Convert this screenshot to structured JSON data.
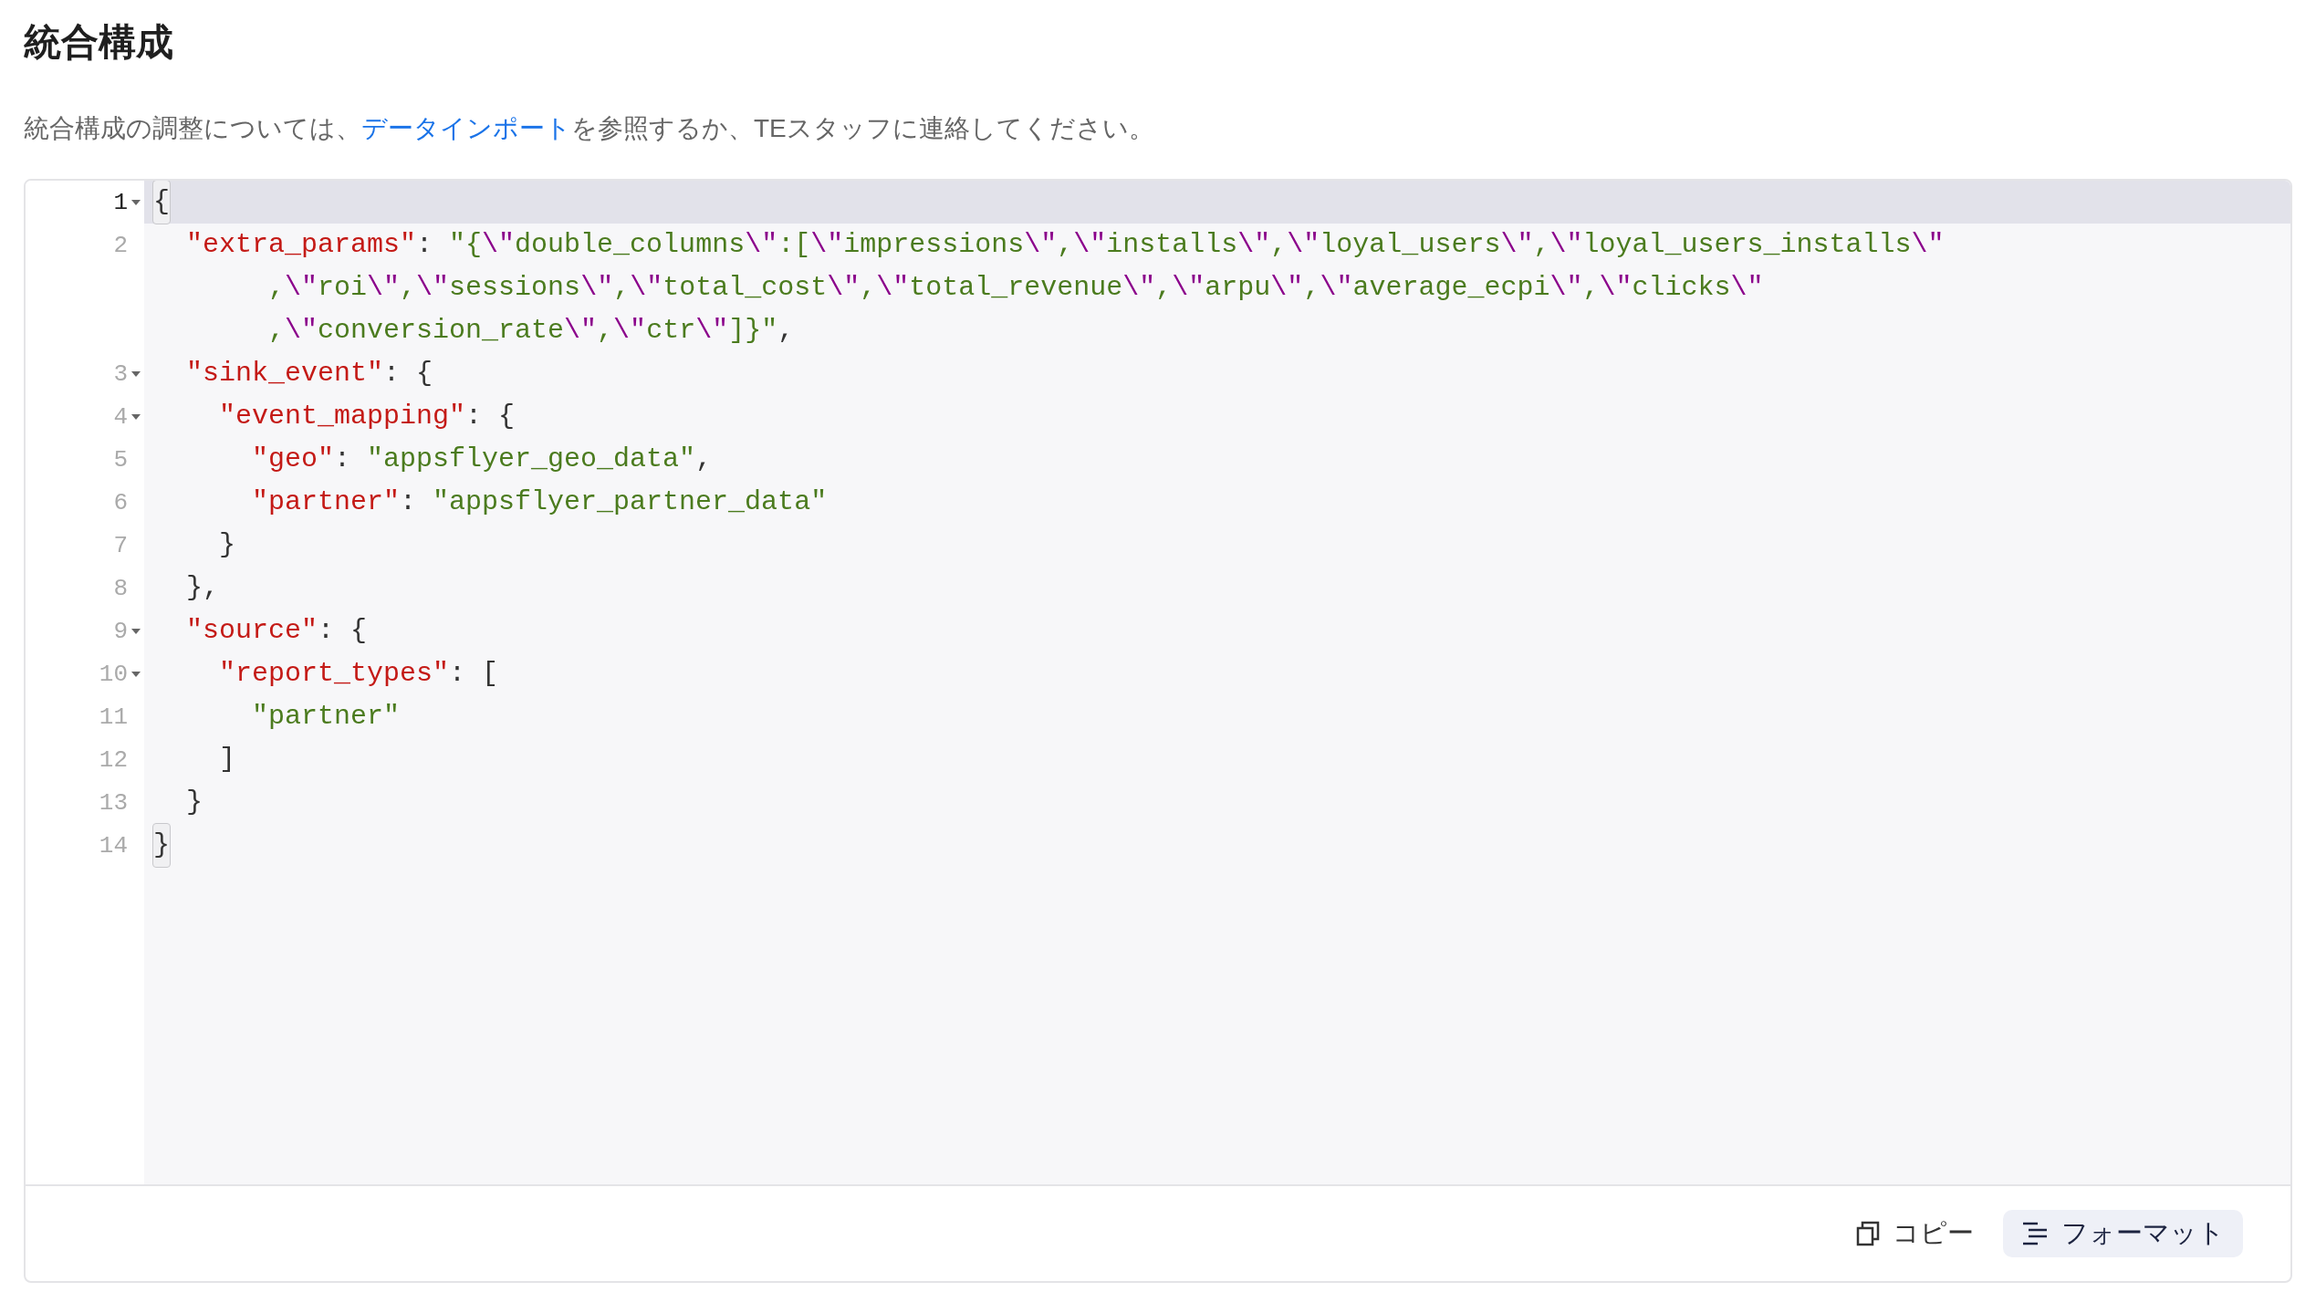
{
  "title": "統合構成",
  "description": {
    "before": "統合構成の調整については、",
    "link": "データインポート",
    "after": "を参照するか、TEスタッフに連絡してください。"
  },
  "editor": {
    "lines": [
      {
        "number": "1",
        "foldable": true,
        "active": true,
        "parts": [
          {
            "tokens": [
              {
                "kind": "punc",
                "text": "{",
                "matched": true
              }
            ]
          }
        ]
      },
      {
        "number": "2",
        "foldable": false,
        "active": false,
        "parts": [
          {
            "tokens": [
              {
                "kind": "key",
                "text": "  \"extra_params\""
              },
              {
                "kind": "punc",
                "text": ": "
              },
              {
                "kind": "str",
                "text": "\"{"
              },
              {
                "kind": "esc",
                "text": "\\\""
              },
              {
                "kind": "str",
                "text": "double_columns"
              },
              {
                "kind": "esc",
                "text": "\\\""
              },
              {
                "kind": "str",
                "text": ":["
              },
              {
                "kind": "esc",
                "text": "\\\""
              },
              {
                "kind": "str",
                "text": "impressions"
              },
              {
                "kind": "esc",
                "text": "\\\""
              },
              {
                "kind": "str",
                "text": ","
              },
              {
                "kind": "esc",
                "text": "\\\""
              },
              {
                "kind": "str",
                "text": "installs"
              },
              {
                "kind": "esc",
                "text": "\\\""
              },
              {
                "kind": "str",
                "text": ","
              },
              {
                "kind": "esc",
                "text": "\\\""
              },
              {
                "kind": "str",
                "text": "loyal_users"
              },
              {
                "kind": "esc",
                "text": "\\\""
              },
              {
                "kind": "str",
                "text": ","
              },
              {
                "kind": "esc",
                "text": "\\\""
              },
              {
                "kind": "str",
                "text": "loyal_users_installs"
              },
              {
                "kind": "esc",
                "text": "\\\""
              }
            ]
          },
          {
            "tokens": [
              {
                "kind": "str",
                "text": ","
              },
              {
                "kind": "esc",
                "text": "\\\""
              },
              {
                "kind": "str",
                "text": "roi"
              },
              {
                "kind": "esc",
                "text": "\\\""
              },
              {
                "kind": "str",
                "text": ","
              },
              {
                "kind": "esc",
                "text": "\\\""
              },
              {
                "kind": "str",
                "text": "sessions"
              },
              {
                "kind": "esc",
                "text": "\\\""
              },
              {
                "kind": "str",
                "text": ","
              },
              {
                "kind": "esc",
                "text": "\\\""
              },
              {
                "kind": "str",
                "text": "total_cost"
              },
              {
                "kind": "esc",
                "text": "\\\""
              },
              {
                "kind": "str",
                "text": ","
              },
              {
                "kind": "esc",
                "text": "\\\""
              },
              {
                "kind": "str",
                "text": "total_revenue"
              },
              {
                "kind": "esc",
                "text": "\\\""
              },
              {
                "kind": "str",
                "text": ","
              },
              {
                "kind": "esc",
                "text": "\\\""
              },
              {
                "kind": "str",
                "text": "arpu"
              },
              {
                "kind": "esc",
                "text": "\\\""
              },
              {
                "kind": "str",
                "text": ","
              },
              {
                "kind": "esc",
                "text": "\\\""
              },
              {
                "kind": "str",
                "text": "average_ecpi"
              },
              {
                "kind": "esc",
                "text": "\\\""
              },
              {
                "kind": "str",
                "text": ","
              },
              {
                "kind": "esc",
                "text": "\\\""
              },
              {
                "kind": "str",
                "text": "clicks"
              },
              {
                "kind": "esc",
                "text": "\\\""
              }
            ]
          },
          {
            "tokens": [
              {
                "kind": "str",
                "text": ","
              },
              {
                "kind": "esc",
                "text": "\\\""
              },
              {
                "kind": "str",
                "text": "conversion_rate"
              },
              {
                "kind": "esc",
                "text": "\\\""
              },
              {
                "kind": "str",
                "text": ","
              },
              {
                "kind": "esc",
                "text": "\\\""
              },
              {
                "kind": "str",
                "text": "ctr"
              },
              {
                "kind": "esc",
                "text": "\\\""
              },
              {
                "kind": "str",
                "text": "]}\""
              },
              {
                "kind": "punc",
                "text": ","
              }
            ]
          }
        ]
      },
      {
        "number": "3",
        "foldable": true,
        "active": false,
        "parts": [
          {
            "tokens": [
              {
                "kind": "key",
                "text": "  \"sink_event\""
              },
              {
                "kind": "punc",
                "text": ": {"
              }
            ]
          }
        ]
      },
      {
        "number": "4",
        "foldable": true,
        "active": false,
        "parts": [
          {
            "tokens": [
              {
                "kind": "key",
                "text": "    \"event_mapping\""
              },
              {
                "kind": "punc",
                "text": ": {"
              }
            ]
          }
        ]
      },
      {
        "number": "5",
        "foldable": false,
        "active": false,
        "parts": [
          {
            "tokens": [
              {
                "kind": "key",
                "text": "      \"geo\""
              },
              {
                "kind": "punc",
                "text": ": "
              },
              {
                "kind": "str",
                "text": "\"appsflyer_geo_data\""
              },
              {
                "kind": "punc",
                "text": ","
              }
            ]
          }
        ]
      },
      {
        "number": "6",
        "foldable": false,
        "active": false,
        "parts": [
          {
            "tokens": [
              {
                "kind": "key",
                "text": "      \"partner\""
              },
              {
                "kind": "punc",
                "text": ": "
              },
              {
                "kind": "str",
                "text": "\"appsflyer_partner_data\""
              }
            ]
          }
        ]
      },
      {
        "number": "7",
        "foldable": false,
        "active": false,
        "parts": [
          {
            "tokens": [
              {
                "kind": "punc",
                "text": "    }"
              }
            ]
          }
        ]
      },
      {
        "number": "8",
        "foldable": false,
        "active": false,
        "parts": [
          {
            "tokens": [
              {
                "kind": "punc",
                "text": "  },"
              }
            ]
          }
        ]
      },
      {
        "number": "9",
        "foldable": true,
        "active": false,
        "parts": [
          {
            "tokens": [
              {
                "kind": "key",
                "text": "  \"source\""
              },
              {
                "kind": "punc",
                "text": ": {"
              }
            ]
          }
        ]
      },
      {
        "number": "10",
        "foldable": true,
        "active": false,
        "parts": [
          {
            "tokens": [
              {
                "kind": "key",
                "text": "    \"report_types\""
              },
              {
                "kind": "punc",
                "text": ": ["
              }
            ]
          }
        ]
      },
      {
        "number": "11",
        "foldable": false,
        "active": false,
        "parts": [
          {
            "tokens": [
              {
                "kind": "str",
                "text": "      \"partner\""
              }
            ]
          }
        ]
      },
      {
        "number": "12",
        "foldable": false,
        "active": false,
        "parts": [
          {
            "tokens": [
              {
                "kind": "punc",
                "text": "    ]"
              }
            ]
          }
        ]
      },
      {
        "number": "13",
        "foldable": false,
        "active": false,
        "parts": [
          {
            "tokens": [
              {
                "kind": "punc",
                "text": "  }"
              }
            ]
          }
        ]
      },
      {
        "number": "14",
        "foldable": false,
        "active": false,
        "parts": [
          {
            "tokens": [
              {
                "kind": "punc",
                "text": "}",
                "matched": true
              }
            ]
          }
        ]
      }
    ]
  },
  "buttons": [
    {
      "kind": "copy",
      "label": "コピー"
    },
    {
      "kind": "format",
      "label": "フォーマット"
    }
  ]
}
